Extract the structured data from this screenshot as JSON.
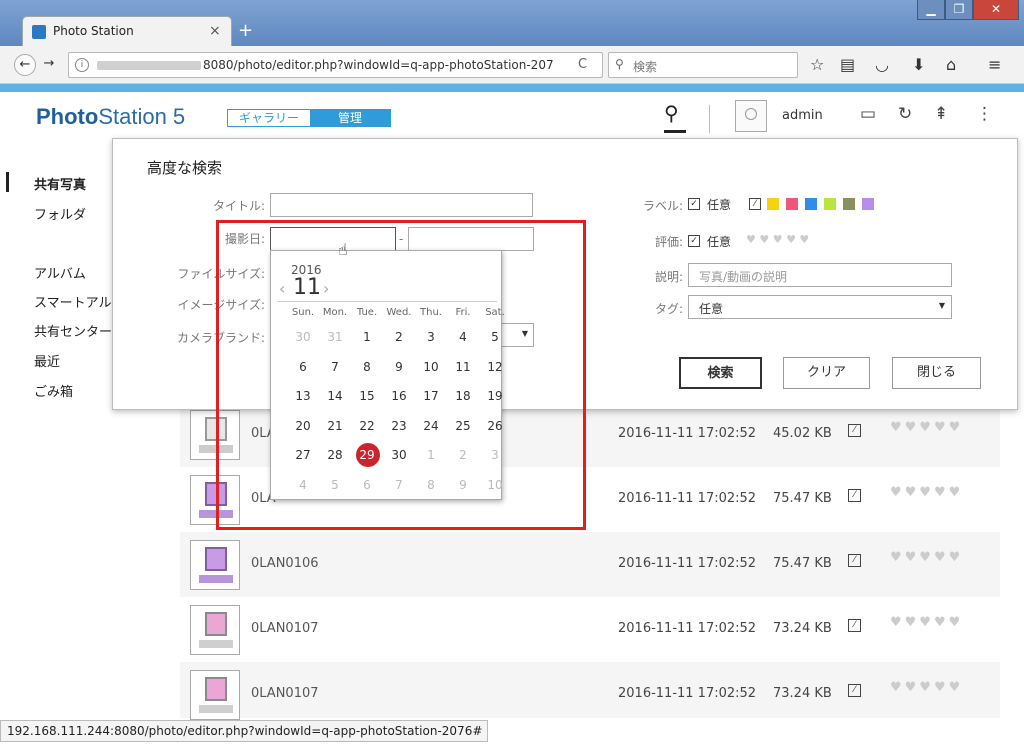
{
  "browser": {
    "tab_title": "Photo Station",
    "tab_close": "×",
    "new_tab": "+",
    "window_min": "▁",
    "window_max": "❐",
    "window_close": "✕",
    "back": "←",
    "forward": "→",
    "info": "i",
    "url": "8080/photo/editor.php?windowId=q-app-photoStation-207",
    "reload": "C",
    "search_placeholder": "検索"
  },
  "app": {
    "logo_bold": "Photo",
    "logo_rest": "Station 5",
    "mode_gallery": "ギャラリー",
    "mode_manage": "管理",
    "username": "admin"
  },
  "sidebar": {
    "items": [
      "共有写真",
      "フォルダ",
      "アルバム",
      "スマートアルバ",
      "共有センター",
      "最近",
      "ごみ箱"
    ]
  },
  "search_panel": {
    "title": "高度な検索",
    "labels": {
      "title": "タイトル:",
      "date": "撮影日:",
      "file_size": "ファイルサイズ:",
      "image_size": "イメージサイズ:",
      "camera_brand": "カメラブランド:",
      "label": "ラベル:",
      "rating": "評価:",
      "description": "説明:",
      "tag": "タグ:"
    },
    "date_separator": "-",
    "label_any": "任意",
    "rating_any": "任意",
    "rating_hearts": "♥ ♥ ♥ ♥ ♥",
    "description_placeholder": "写真/動画の説明",
    "tag_value": "任意",
    "buttons": {
      "search": "検索",
      "clear": "クリア",
      "close": "閉じる"
    },
    "label_colors": [
      "#f5d311",
      "#f2557a",
      "#2f8fe8",
      "#b7e640",
      "#8a9060",
      "#b98ee8"
    ]
  },
  "calendar": {
    "year": "2016",
    "month": "11",
    "prev": "‹",
    "next": "›",
    "weekdays": [
      "Sun.",
      "Mon.",
      "Tue.",
      "Wed.",
      "Thu.",
      "Fri.",
      "Sat."
    ],
    "weeks": [
      [
        "30",
        "31",
        "1",
        "2",
        "3",
        "4",
        "5"
      ],
      [
        "6",
        "7",
        "8",
        "9",
        "10",
        "11",
        "12"
      ],
      [
        "13",
        "14",
        "15",
        "16",
        "17",
        "18",
        "19"
      ],
      [
        "20",
        "21",
        "22",
        "23",
        "24",
        "25",
        "26"
      ],
      [
        "27",
        "28",
        "29",
        "30",
        "1",
        "2",
        "3"
      ],
      [
        "4",
        "5",
        "6",
        "7",
        "8",
        "9",
        "10"
      ]
    ],
    "selected": "29"
  },
  "file_rows": [
    {
      "name": "0LA",
      "date": "2016-11-11 17:02:52",
      "size": "45.02 KB"
    },
    {
      "name": "0LA",
      "date": "2016-11-11 17:02:52",
      "size": "75.47 KB"
    },
    {
      "name": "0LAN0106",
      "date": "2016-11-11 17:02:52",
      "size": "75.47 KB"
    },
    {
      "name": "0LAN0107",
      "date": "2016-11-11 17:02:52",
      "size": "73.24 KB"
    },
    {
      "name": "0LAN0107",
      "date": "2016-11-11 17:02:52",
      "size": "73.24 KB"
    }
  ],
  "row_hearts": "♥♥♥♥♥",
  "status_url": "192.168.111.244:8080/photo/editor.php?windowId=q-app-photoStation-2076#"
}
